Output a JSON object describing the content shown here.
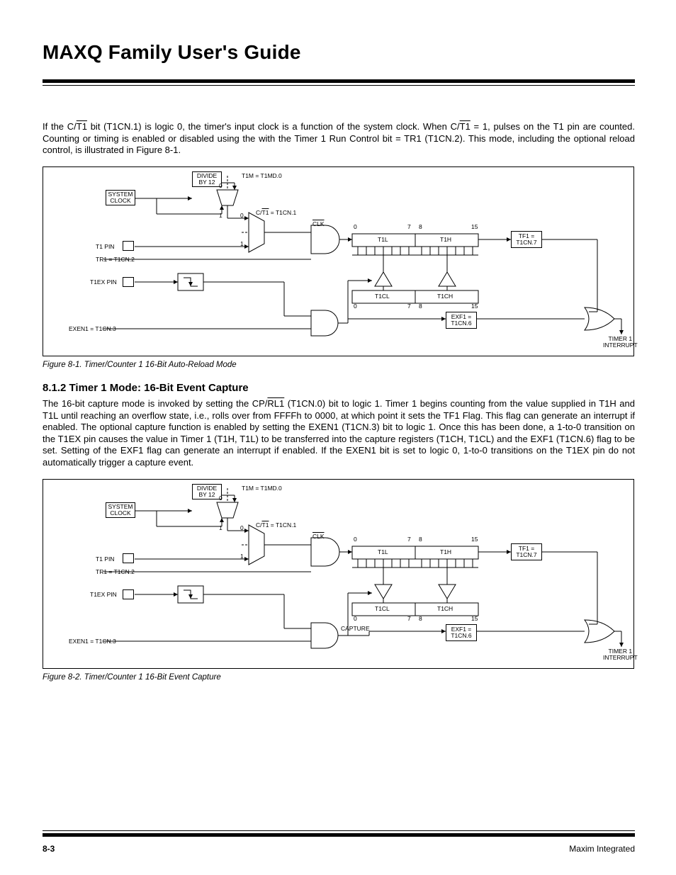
{
  "header": {
    "title": "MAXQ Family User's Guide"
  },
  "para1_pre": "If the C/",
  "para1_mid": " bit (T1CN.1) is logic 0, the timer's input clock is a function of the system clock. When C/",
  "para1_post": " = 1, pulses on the T1 pin are counted. Counting or timing is enabled or disabled using the with the Timer 1 Run Control bit = TR1 (T1CN.2). This mode, including the optional reload control, is illustrated in Figure 8-1.",
  "para1_ov": "T1",
  "fig1": {
    "caption": "Figure 8-1. Timer/Counter 1 16-Bit Auto-Reload Mode",
    "labels": {
      "divide": "DIVIDE\nBY 12",
      "sysclock": "SYSTEM\nCLOCK",
      "t1m": "T1M = T1MD.0",
      "ct1_pre": "C/",
      "ct1_ov": "T1",
      "ct1_post": " = T1CN.1",
      "clk_pre": "",
      "clk_ov": "CLK",
      "t1pin": "T1 PIN",
      "tr1": "TR1 = T1CN.2",
      "t1ex": "T1EX PIN",
      "exen1": "EXEN1 = T1CN.3",
      "t1l": "T1L",
      "t1h": "T1H",
      "t1cl": "T1CL",
      "t1ch": "T1CH",
      "b0": "0",
      "b7": "7",
      "b8": "8",
      "b15": "15",
      "tf1": "TF1 =\nT1CN.7",
      "exf1": "EXF1 =\nT1CN.6",
      "timint": "TIMER 1\nINTERRUPT",
      "one": "1",
      "zero": "0"
    }
  },
  "sec812_head": "8.1.2 Timer 1 Mode: 16-Bit Event Capture",
  "para2_pre": "The 16-bit capture mode is invoked by setting the CP/",
  "para2_ov": "RL1",
  "para2_post": " (T1CN.0) bit to logic 1. Timer 1 begins counting from the value supplied in T1H and T1L until reaching an overflow state, i.e., rolls over from FFFFh to 0000, at which point it sets the TF1 Flag. This flag can generate an interrupt if enabled. The optional capture function is enabled by setting the EXEN1 (T1CN.3) bit to logic 1. Once this has been done, a 1-to-0 transition on the T1EX pin causes the value in Timer 1 (T1H, T1L) to be transferred into the capture registers (T1CH, T1CL) and the EXF1 (T1CN.6) flag to be set. Setting of the EXF1 flag can generate an interrupt if enabled. If the EXEN1 bit is set to logic 0, 1-to-0 transitions on the T1EX pin do not automatically trigger a capture event.",
  "fig2": {
    "caption": "Figure 8-2. Timer/Counter 1 16-Bit Event Capture",
    "capture": "CAPTURE"
  },
  "footer": {
    "page": "8-3",
    "brand": "Maxim Integrated"
  }
}
